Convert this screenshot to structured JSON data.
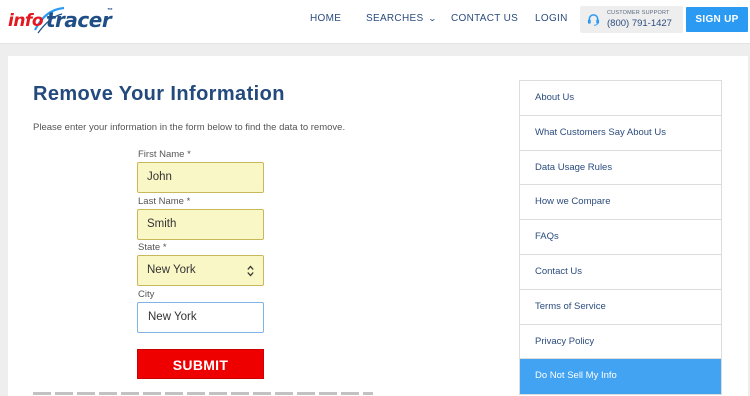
{
  "brand": {
    "logo_info": "info",
    "logo_tracer": "tracer",
    "logo_tm": "™",
    "accent": "#e5171e",
    "primary": "#1f4f86"
  },
  "nav": {
    "home": "HOME",
    "searches": "SEARCHES",
    "contact": "CONTACT US",
    "login": "LOGIN",
    "support_label": "CUSTOMER SUPPORT",
    "support_phone": "(800) 791-1427",
    "signup": "SIGN UP"
  },
  "main": {
    "title": "Remove Your Information",
    "intro": "Please enter your information in the form below to find the data to remove."
  },
  "form": {
    "first_name_label": "First Name *",
    "first_name_value": "John",
    "last_name_label": "Last Name *",
    "last_name_value": "Smith",
    "state_label": "State *",
    "state_value": "New York",
    "city_label": "City",
    "city_value": "New York",
    "submit": "SUBMIT"
  },
  "sidebar": {
    "items": [
      {
        "label": "About Us"
      },
      {
        "label": "What Customers Say About Us"
      },
      {
        "label": "Data Usage Rules"
      },
      {
        "label": "How we Compare"
      },
      {
        "label": "FAQs"
      },
      {
        "label": "Contact Us"
      },
      {
        "label": "Terms of Service"
      },
      {
        "label": "Privacy Policy"
      },
      {
        "label": "Do Not Sell My Info",
        "active": true
      }
    ]
  },
  "colors": {
    "submit_bg": "#ee0000",
    "signup_bg": "#2b9af3",
    "active_item_bg": "#42a3f3",
    "field_highlight": "#faf7c7"
  }
}
